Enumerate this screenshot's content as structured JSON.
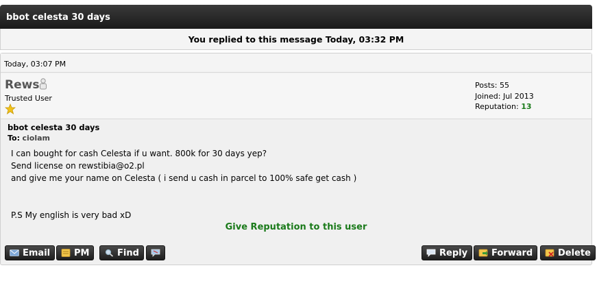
{
  "thread": {
    "title": "bbot celesta 30 days"
  },
  "notice": "You replied to this message Today, 03:32 PM",
  "post": {
    "date": "Today, 03:07 PM",
    "user": {
      "name": "Rews",
      "title": "Trusted User",
      "posts_label": "Posts: 55",
      "joined_label": "Joined: Jul 2013",
      "reputation_label": "Reputation:",
      "reputation_value": "13"
    },
    "message": {
      "title": "bbot celesta 30 days",
      "to_label": "To:",
      "to_name": "ciolam",
      "lines": [
        "I can bought for cash Celesta if u want. 800k for 30 days yep?",
        "Send license on rewstibia@o2.pl",
        "and give me your name on Celesta ( i send u cash in parcel to 100% safe get cash )",
        "",
        "",
        "P.S My english is very bad xD"
      ]
    },
    "give_reputation": "Give Reputation to this user"
  },
  "buttons": {
    "email": "Email",
    "pm": "PM",
    "find": "Find",
    "reply": "Reply",
    "forward": "Forward",
    "delete": "Delete"
  },
  "colors": {
    "reputation": "#1a7a1a",
    "titlebar": "#222222"
  }
}
